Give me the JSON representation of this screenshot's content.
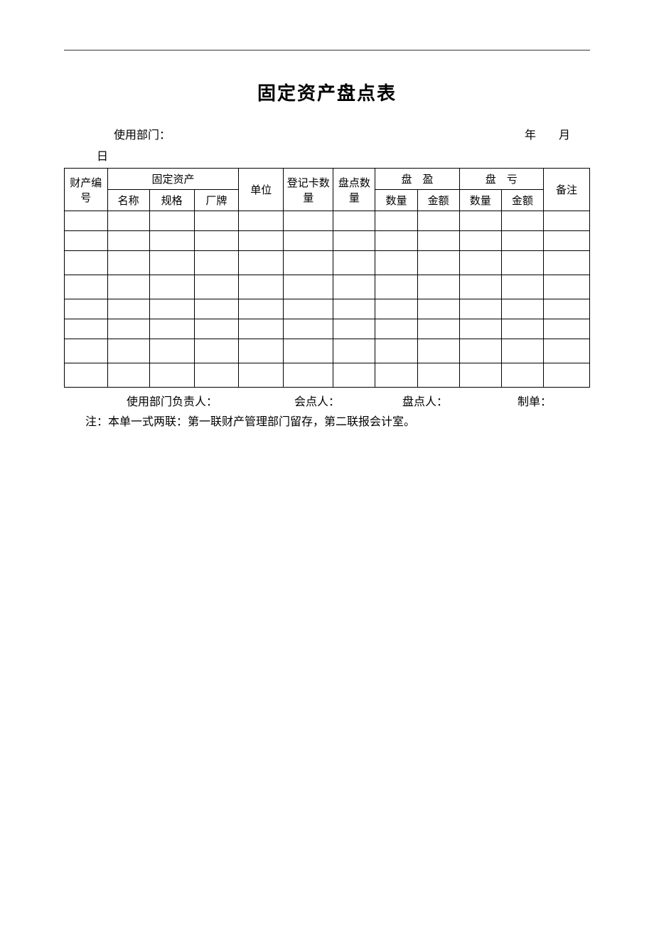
{
  "title": "固定资产盘点表",
  "meta": {
    "dept_label": "使用部门：",
    "year_label": "年",
    "month_label": "月",
    "day_label": "日"
  },
  "headers": {
    "asset_no": "财产编号",
    "fixed_asset": "固定资产",
    "name": "名称",
    "spec": "规格",
    "brand": "厂牌",
    "unit": "单位",
    "reg_qty": "登记卡数量",
    "chk_qty": "盘点数量",
    "surplus": "盘　盈",
    "deficit": "盘　亏",
    "qty": "数量",
    "amount": "金额",
    "remark": "备注"
  },
  "rows": [
    {
      "asset_no": "",
      "name": "",
      "spec": "",
      "brand": "",
      "unit": "",
      "reg_qty": "",
      "chk_qty": "",
      "surplus_qty": "",
      "surplus_amt": "",
      "deficit_qty": "",
      "deficit_amt": "",
      "remark": ""
    },
    {
      "asset_no": "",
      "name": "",
      "spec": "",
      "brand": "",
      "unit": "",
      "reg_qty": "",
      "chk_qty": "",
      "surplus_qty": "",
      "surplus_amt": "",
      "deficit_qty": "",
      "deficit_amt": "",
      "remark": ""
    },
    {
      "asset_no": "",
      "name": "",
      "spec": "",
      "brand": "",
      "unit": "",
      "reg_qty": "",
      "chk_qty": "",
      "surplus_qty": "",
      "surplus_amt": "",
      "deficit_qty": "",
      "deficit_amt": "",
      "remark": ""
    },
    {
      "asset_no": "",
      "name": "",
      "spec": "",
      "brand": "",
      "unit": "",
      "reg_qty": "",
      "chk_qty": "",
      "surplus_qty": "",
      "surplus_amt": "",
      "deficit_qty": "",
      "deficit_amt": "",
      "remark": ""
    },
    {
      "asset_no": "",
      "name": "",
      "spec": "",
      "brand": "",
      "unit": "",
      "reg_qty": "",
      "chk_qty": "",
      "surplus_qty": "",
      "surplus_amt": "",
      "deficit_qty": "",
      "deficit_amt": "",
      "remark": ""
    },
    {
      "asset_no": "",
      "name": "",
      "spec": "",
      "brand": "",
      "unit": "",
      "reg_qty": "",
      "chk_qty": "",
      "surplus_qty": "",
      "surplus_amt": "",
      "deficit_qty": "",
      "deficit_amt": "",
      "remark": ""
    },
    {
      "asset_no": "",
      "name": "",
      "spec": "",
      "brand": "",
      "unit": "",
      "reg_qty": "",
      "chk_qty": "",
      "surplus_qty": "",
      "surplus_amt": "",
      "deficit_qty": "",
      "deficit_amt": "",
      "remark": ""
    },
    {
      "asset_no": "",
      "name": "",
      "spec": "",
      "brand": "",
      "unit": "",
      "reg_qty": "",
      "chk_qty": "",
      "surplus_qty": "",
      "surplus_amt": "",
      "deficit_qty": "",
      "deficit_amt": "",
      "remark": ""
    }
  ],
  "signatures": {
    "s1": "使用部门负责人：",
    "s2": "会点人：",
    "s3": "盘点人：",
    "s4": "制单："
  },
  "note": "注：本单一式两联：第一联财产管理部门留存，第二联报会计室。"
}
